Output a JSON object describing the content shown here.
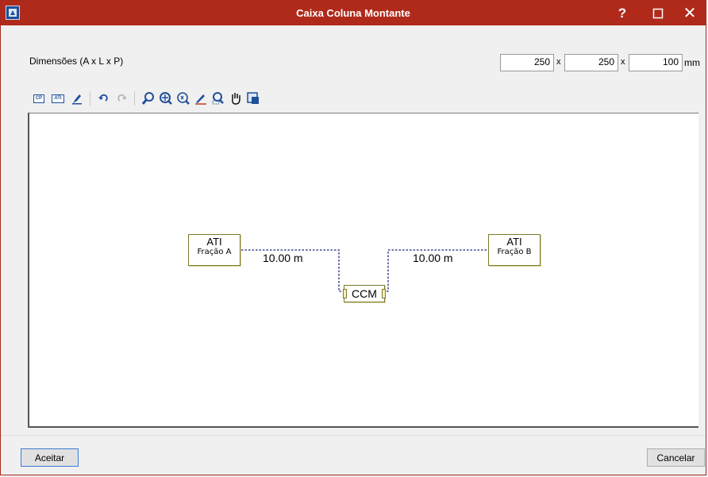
{
  "window": {
    "title": "Caixa Coluna Montante"
  },
  "titlebar": {
    "help": "?",
    "maximize": "☐",
    "close": "✕"
  },
  "dimensions": {
    "label": "Dimensões (A x L x P)",
    "a": "250",
    "l": "250",
    "p": "100",
    "sep": "x",
    "unit": "mm"
  },
  "toolbar": {
    "cp_label": "CP",
    "ati_label": "ATI",
    "icons": [
      "cp-icon",
      "ati-icon",
      "pen-icon",
      "undo-icon",
      "redo-icon",
      "zoom-extents-icon",
      "zoom-window-icon",
      "zoom-x2-icon",
      "zoom-pencil-icon",
      "zoom-select-icon",
      "pan-hand-icon",
      "window-icon"
    ]
  },
  "diagram": {
    "node_a": {
      "title": "ATI",
      "sub": "Fração A"
    },
    "node_b": {
      "title": "ATI",
      "sub": "Fração B"
    },
    "ccm": {
      "label": "CCM"
    },
    "dist_left": "10.00 m",
    "dist_right": "10.00 m",
    "line_color": "#1a237e",
    "node_border": "#7d7a2a"
  },
  "buttons": {
    "accept": "Aceitar",
    "cancel": "Cancelar"
  },
  "colors": {
    "titlebar": "#b02a1b",
    "accent": "#1e4f9a"
  }
}
